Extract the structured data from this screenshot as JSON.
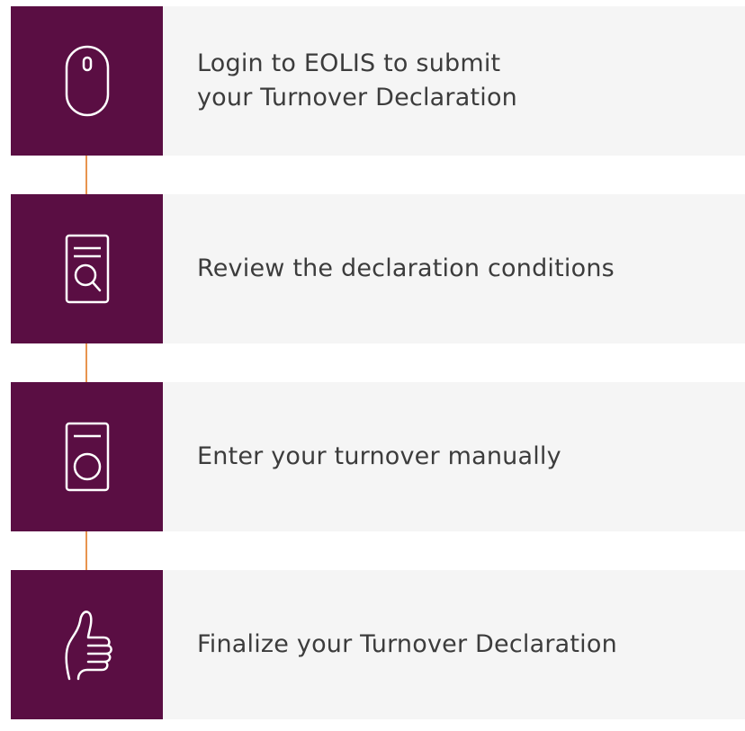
{
  "colors": {
    "icon_background": "#5a0e43",
    "card_background": "#f5f5f5",
    "connector": "#e8944f",
    "text": "#3c3c3c",
    "icon_stroke": "#ffffff"
  },
  "steps": [
    {
      "icon": "mouse-icon",
      "text": "Login to EOLIS to submit\nyour Turnover Declaration"
    },
    {
      "icon": "document-search-icon",
      "text": "Review the declaration conditions"
    },
    {
      "icon": "document-circle-icon",
      "text": "Enter your turnover manually"
    },
    {
      "icon": "thumbs-up-icon",
      "text": "Finalize your Turnover Declaration"
    }
  ]
}
